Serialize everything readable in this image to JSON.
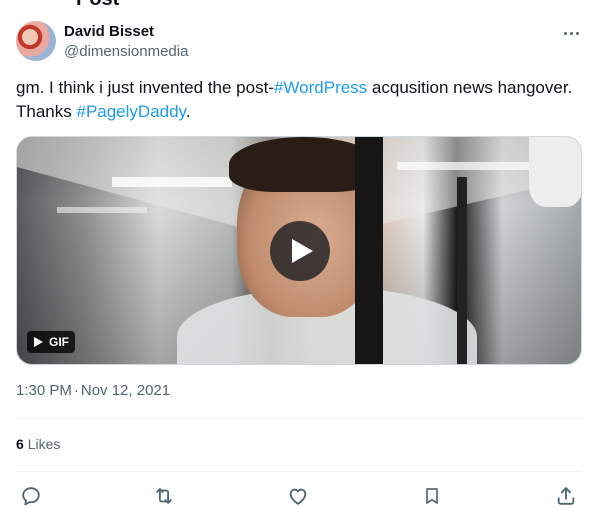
{
  "header": {
    "title_fragment": "Post"
  },
  "author": {
    "name": "David Bisset",
    "handle": "@dimensionmedia"
  },
  "tweet": {
    "text_part1": "gm. I think i just invented the post-",
    "hashtag1": "#WordPress",
    "text_part2": " acqusition news hangover. Thanks ",
    "hashtag2": "#PagelyDaddy",
    "text_part3": "."
  },
  "media": {
    "badge_label": "GIF",
    "icons": {
      "play": "play-icon",
      "gif": "gif-play-icon"
    }
  },
  "meta": {
    "time": "1:30 PM",
    "separator": "·",
    "date": "Nov 12, 2021"
  },
  "stats": {
    "likes_count": "6",
    "likes_label": "Likes"
  },
  "actions": {
    "icons": [
      "reply-icon",
      "retweet-icon",
      "like-icon",
      "bookmark-icon",
      "share-icon"
    ]
  },
  "colors": {
    "accent": "#1d9bf0",
    "text_primary": "#0f1419",
    "text_secondary": "#536471",
    "divider": "#eff3f4"
  }
}
